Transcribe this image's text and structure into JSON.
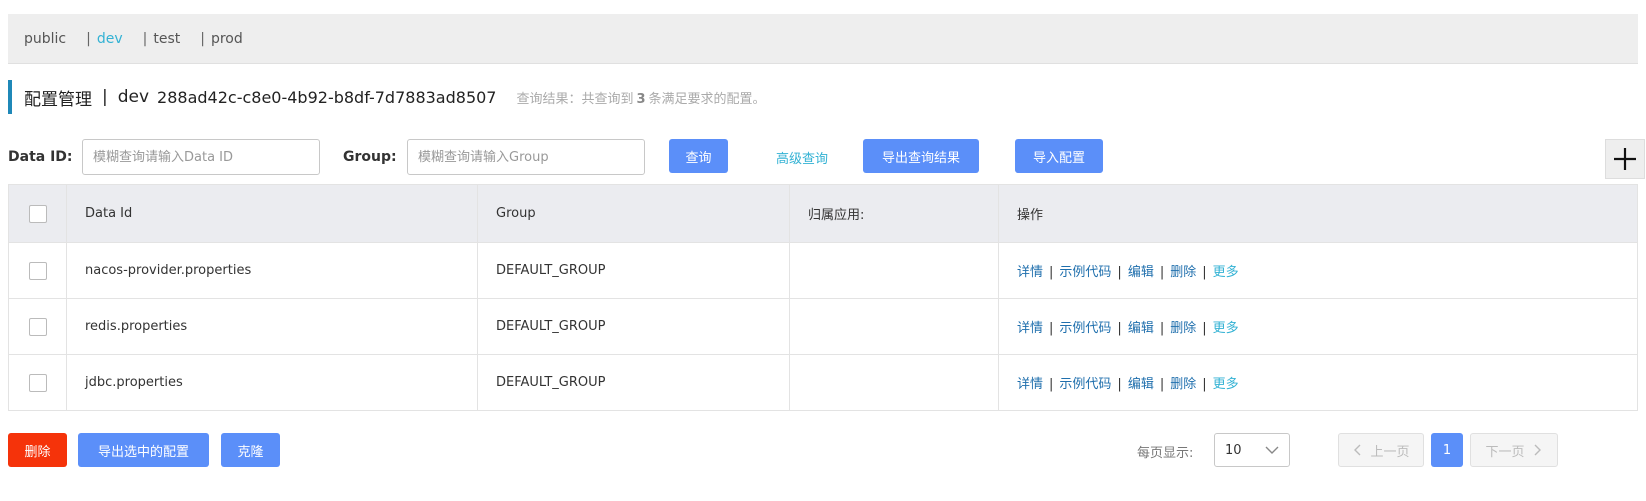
{
  "namespaces": [
    "public",
    "dev",
    "test",
    "prod"
  ],
  "active_namespace": "dev",
  "header": {
    "title": "配置管理",
    "separator": "|",
    "namespace": "dev",
    "namespace_id": "288ad42c-c8e0-4b92-b8df-7d7883ad8507",
    "result_prefix": "查询结果：共查询到",
    "result_count": "3",
    "result_suffix": "条满足要求的配置。"
  },
  "search": {
    "data_id_label": "Data ID:",
    "data_id_placeholder": "模糊查询请输入Data ID",
    "group_label": "Group:",
    "group_placeholder": "模糊查询请输入Group",
    "query_button": "查询",
    "advanced_link": "高级查询",
    "export_button": "导出查询结果",
    "import_button": "导入配置",
    "add_icon": "plus-icon"
  },
  "table": {
    "headers": [
      "Data Id",
      "Group",
      "归属应用:",
      "操作"
    ],
    "rows": [
      {
        "data_id": "nacos-provider.properties",
        "group": "DEFAULT_GROUP",
        "app": ""
      },
      {
        "data_id": "redis.properties",
        "group": "DEFAULT_GROUP",
        "app": ""
      },
      {
        "data_id": "jdbc.properties",
        "group": "DEFAULT_GROUP",
        "app": ""
      }
    ],
    "actions": {
      "detail": "详情",
      "sample": "示例代码",
      "edit": "编辑",
      "delete": "删除",
      "more": "更多",
      "separator": "|"
    }
  },
  "footer": {
    "delete_button": "删除",
    "export_selected_button": "导出选中的配置",
    "clone_button": "克隆",
    "page_size_label": "每页显示:",
    "page_size_value": "10",
    "prev_label": "上一页",
    "next_label": "下一页",
    "current_page": "1"
  },
  "colors": {
    "primary": "#5b8ff9",
    "danger": "#f5330a",
    "link": "#1f6fad",
    "accent": "#33b2d4"
  }
}
